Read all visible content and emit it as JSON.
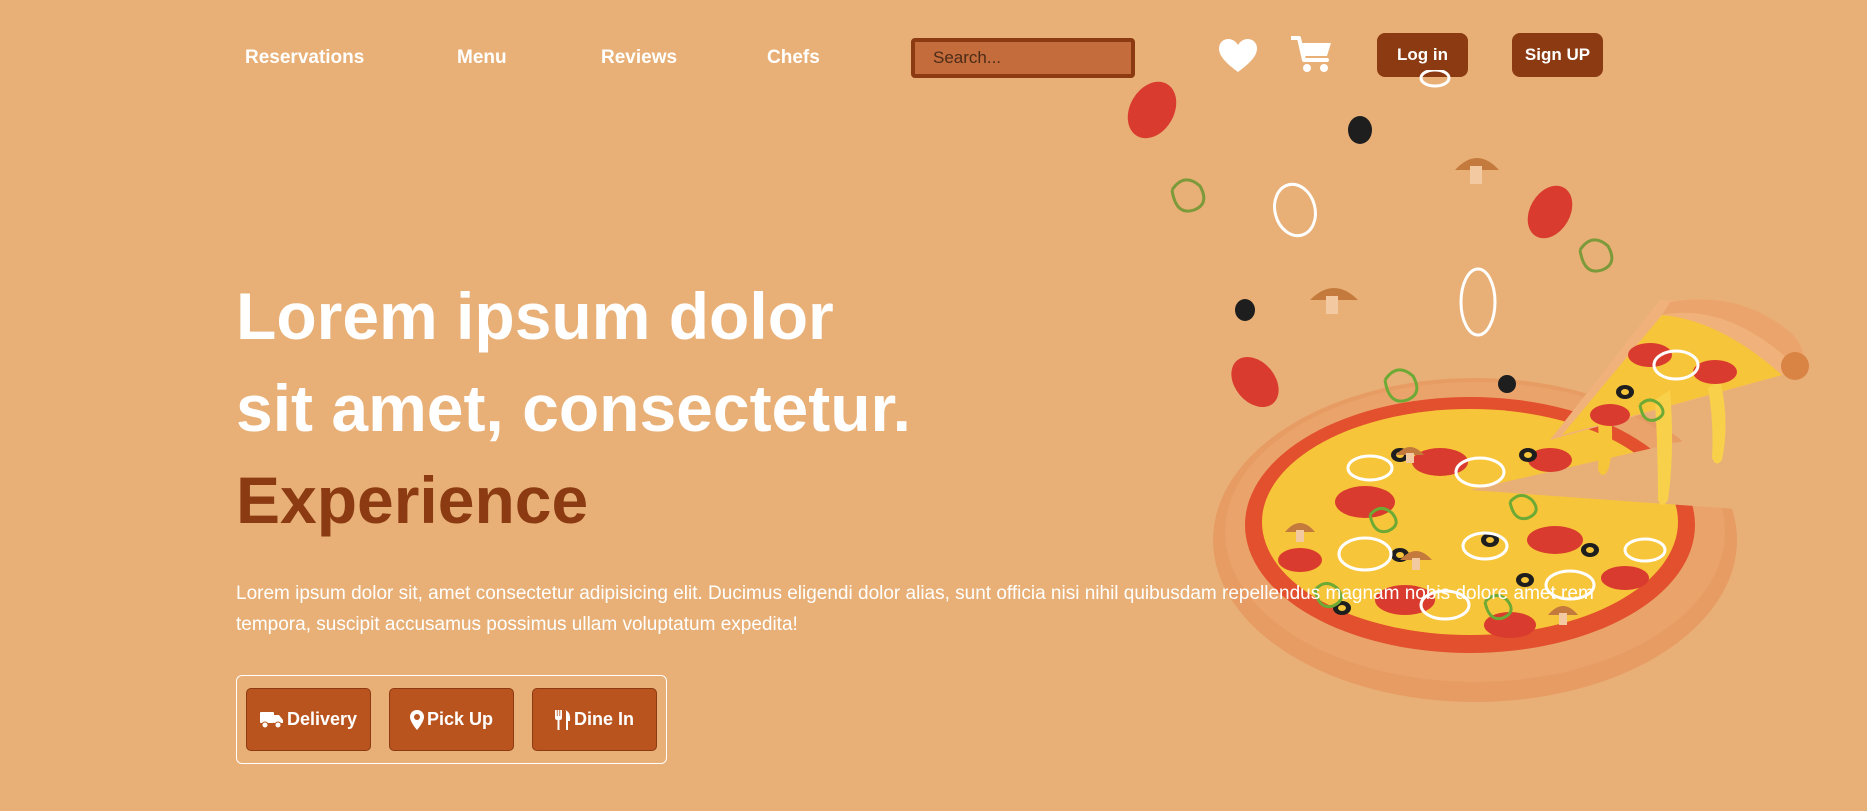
{
  "nav": {
    "links": [
      {
        "label": "Reservations"
      },
      {
        "label": "Menu"
      },
      {
        "label": "Reviews"
      },
      {
        "label": "Chefs"
      }
    ],
    "search_placeholder": "Search...",
    "favorites_icon": "heart-icon",
    "cart_icon": "cart-icon",
    "login_label": "Log in",
    "signup_label": "Sign UP"
  },
  "hero": {
    "line1": "Lorem ipsum dolor",
    "line2": "sit amet, consectetur.",
    "accent": "Experience",
    "description": "Lorem ipsum dolor sit, amet consectetur adipisicing elit. Ducimus eligendi dolor alias, sunt officia nisi nihil quibusdam repellendus magnam nobis dolore amet rem tempora, suscipit accusamus possimus ullam voluptatum expedita!"
  },
  "services": [
    {
      "label": "Delivery",
      "icon": "truck-icon"
    },
    {
      "label": "Pick Up",
      "icon": "map-pin-icon"
    },
    {
      "label": "Dine In",
      "icon": "utensils-icon"
    }
  ],
  "colors": {
    "background": "#E8B077",
    "brand_dark": "#8B3A12",
    "button": "#B9541F",
    "search_bg": "#C56C3C",
    "text_light": "#FFFFFF"
  },
  "illustration": "pizza-illustration"
}
